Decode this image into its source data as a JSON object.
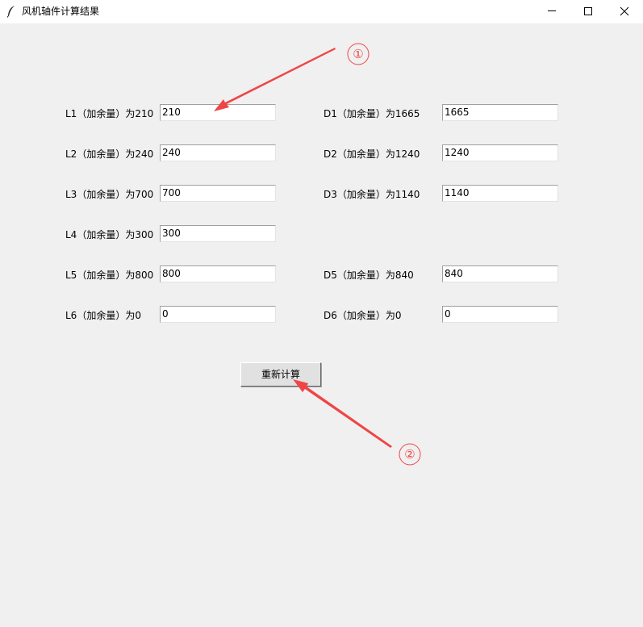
{
  "window": {
    "title": "风机轴件计算结果",
    "icon": "feather-icon",
    "controls": [
      "minimize-icon",
      "maximize-icon",
      "close-icon"
    ]
  },
  "fields": {
    "L1": {
      "label": "L1（加余量）为210",
      "value": "210"
    },
    "L2": {
      "label": "L2（加余量）为240",
      "value": "240"
    },
    "L3": {
      "label": "L3（加余量）为700",
      "value": "700"
    },
    "L4": {
      "label": "L4（加余量）为300",
      "value": "300"
    },
    "L5": {
      "label": "L5（加余量）为800",
      "value": "800"
    },
    "L6": {
      "label": "L6（加余量）为0",
      "value": "0"
    },
    "D1": {
      "label": "D1（加余量）为1665",
      "value": "1665"
    },
    "D2": {
      "label": "D2（加余量）为1240",
      "value": "1240"
    },
    "D3": {
      "label": "D3（加余量）为1140",
      "value": "1140"
    },
    "D5": {
      "label": "D5（加余量）为840",
      "value": "840"
    },
    "D6": {
      "label": "D6（加余量）为0",
      "value": "0"
    }
  },
  "recalculate_label": "重新计算",
  "annotations": {
    "marker1": "①",
    "marker2": "②",
    "color": "#f04545"
  }
}
